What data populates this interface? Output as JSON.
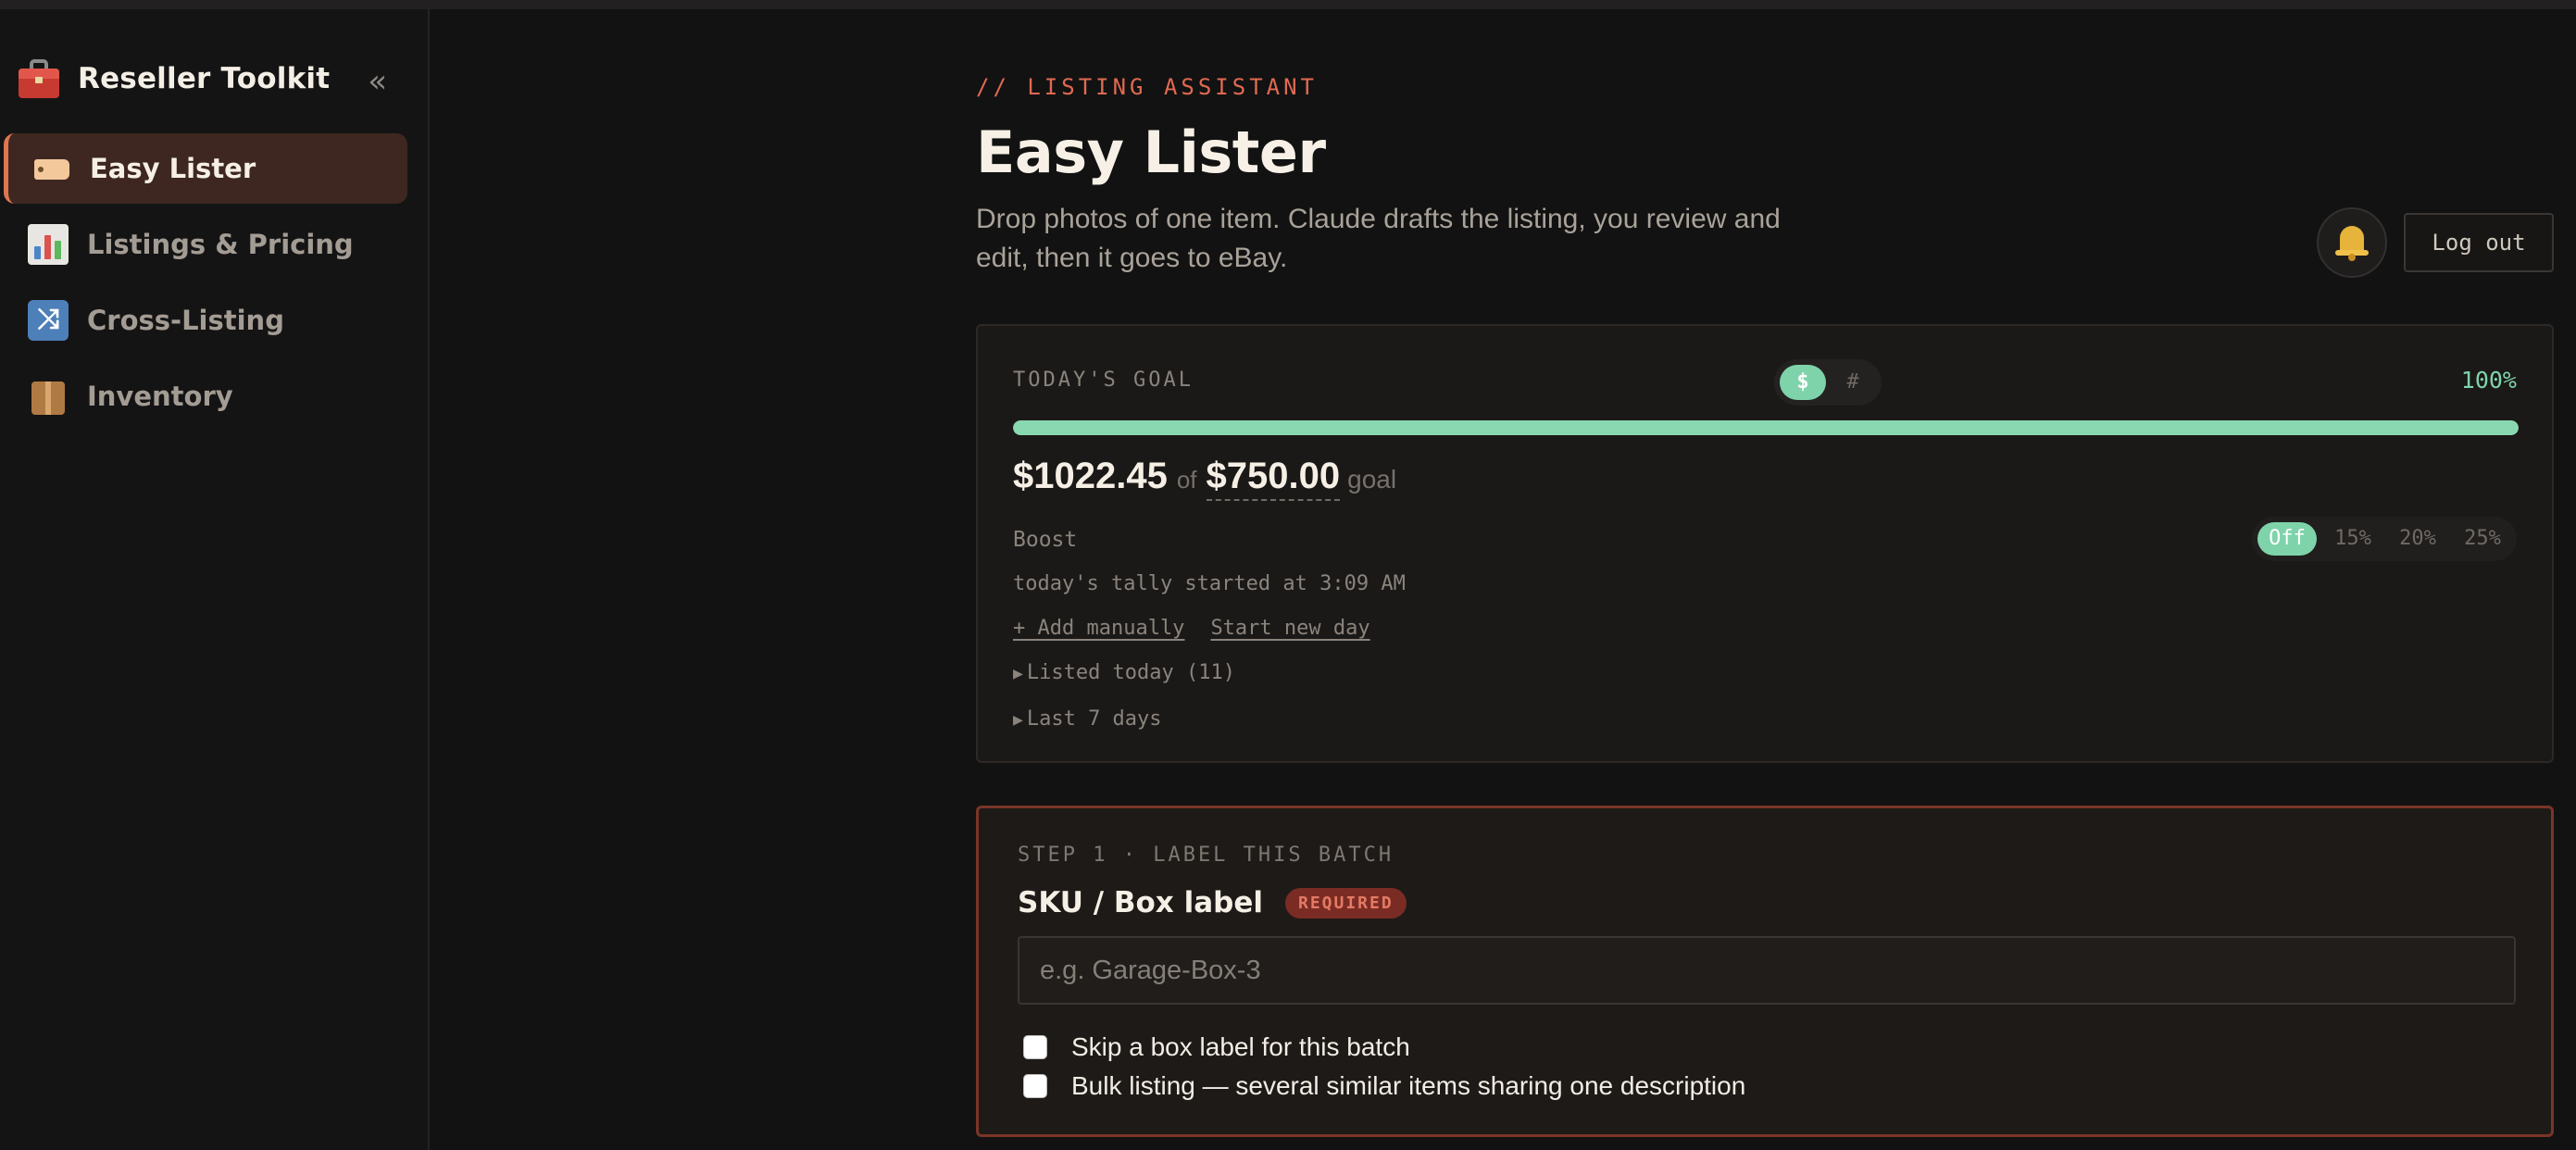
{
  "sidebar": {
    "brand": "Reseller Toolkit",
    "brand_icon": "toolbox-icon",
    "collapse_glyph": "«",
    "items": [
      {
        "label": "Easy Lister",
        "icon": "tag-icon",
        "active": true
      },
      {
        "label": "Listings & Pricing",
        "icon": "bar-chart-icon",
        "active": false
      },
      {
        "label": "Cross-Listing",
        "icon": "shuffle-icon",
        "active": false
      },
      {
        "label": "Inventory",
        "icon": "package-icon",
        "active": false
      }
    ]
  },
  "header": {
    "eyebrow": "// LISTING ASSISTANT",
    "title": "Easy Lister",
    "subtitle": "Drop photos of one item. Claude drafts the listing, you review and edit, then it goes to eBay.",
    "logout_label": "Log out"
  },
  "goal": {
    "label": "TODAY'S GOAL",
    "mode_dollar": "$",
    "mode_count": "#",
    "percent_label": "100%",
    "progress_fraction": 1.0,
    "amount": "$1022.45",
    "of_text": "of",
    "target": "$750.00",
    "goal_word": "goal",
    "boost_label": "Boost",
    "boost_options": [
      "Off",
      "15%",
      "20%",
      "25%"
    ],
    "boost_selected": "Off",
    "tally": "today's tally started at 3:09 AM",
    "add_manually": "+ Add manually",
    "start_new_day": "Start new day",
    "listed_today": "Listed today (11)",
    "last_7_days": "Last 7 days"
  },
  "step1": {
    "eyebrow": "STEP 1 · LABEL THIS BATCH",
    "field_label": "SKU / Box label",
    "required_badge": "REQUIRED",
    "placeholder": "e.g. Garage-Box-3",
    "value": "",
    "skip_label": "Skip a box label for this batch",
    "bulk_label": "Bulk listing — several similar items sharing one description"
  },
  "colors": {
    "accent_green": "#7fd3ab",
    "accent_orange": "#e06a52",
    "active_nav_bg": "#3d2720",
    "required_border": "#7a3527"
  }
}
